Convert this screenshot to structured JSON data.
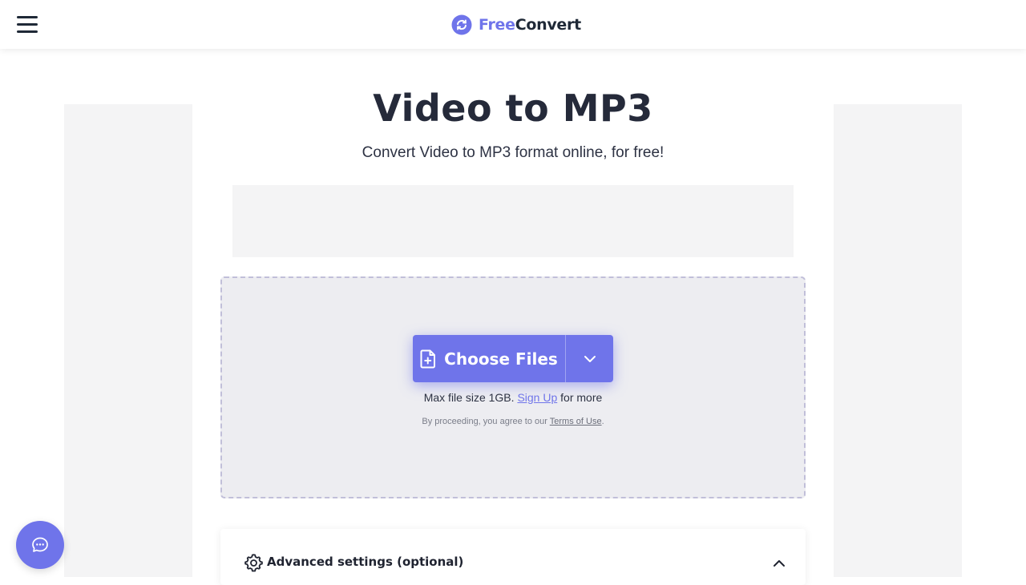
{
  "header": {
    "logo_free": "Free",
    "logo_convert": "Convert",
    "menu_icon": "hamburger-menu-icon",
    "logo_icon": "refresh-circle-icon"
  },
  "main": {
    "title": "Video to MP3",
    "subtitle": "Convert Video to MP3 format online, for free!"
  },
  "upload": {
    "choose_files_label": "Choose Files",
    "file_icon": "file-add-icon",
    "dropdown_icon": "chevron-down-icon",
    "max_size_text": "Max file size 1GB.",
    "signup_link": "Sign Up",
    "for_more_text": "for more",
    "terms_prefix": "By proceeding, you agree to our",
    "terms_link": "Terms of Use",
    "terms_suffix": "."
  },
  "advanced": {
    "label": "Advanced settings (optional)",
    "gear_icon": "gear-icon",
    "toggle_icon": "chevron-up-icon"
  },
  "chat": {
    "icon": "chat-bubble-icon"
  },
  "colors": {
    "brand": "#6f74ea",
    "dropzone_bg": "#ededf1",
    "dropzone_border": "#c1bfd9",
    "text_dark": "#252a3a"
  }
}
